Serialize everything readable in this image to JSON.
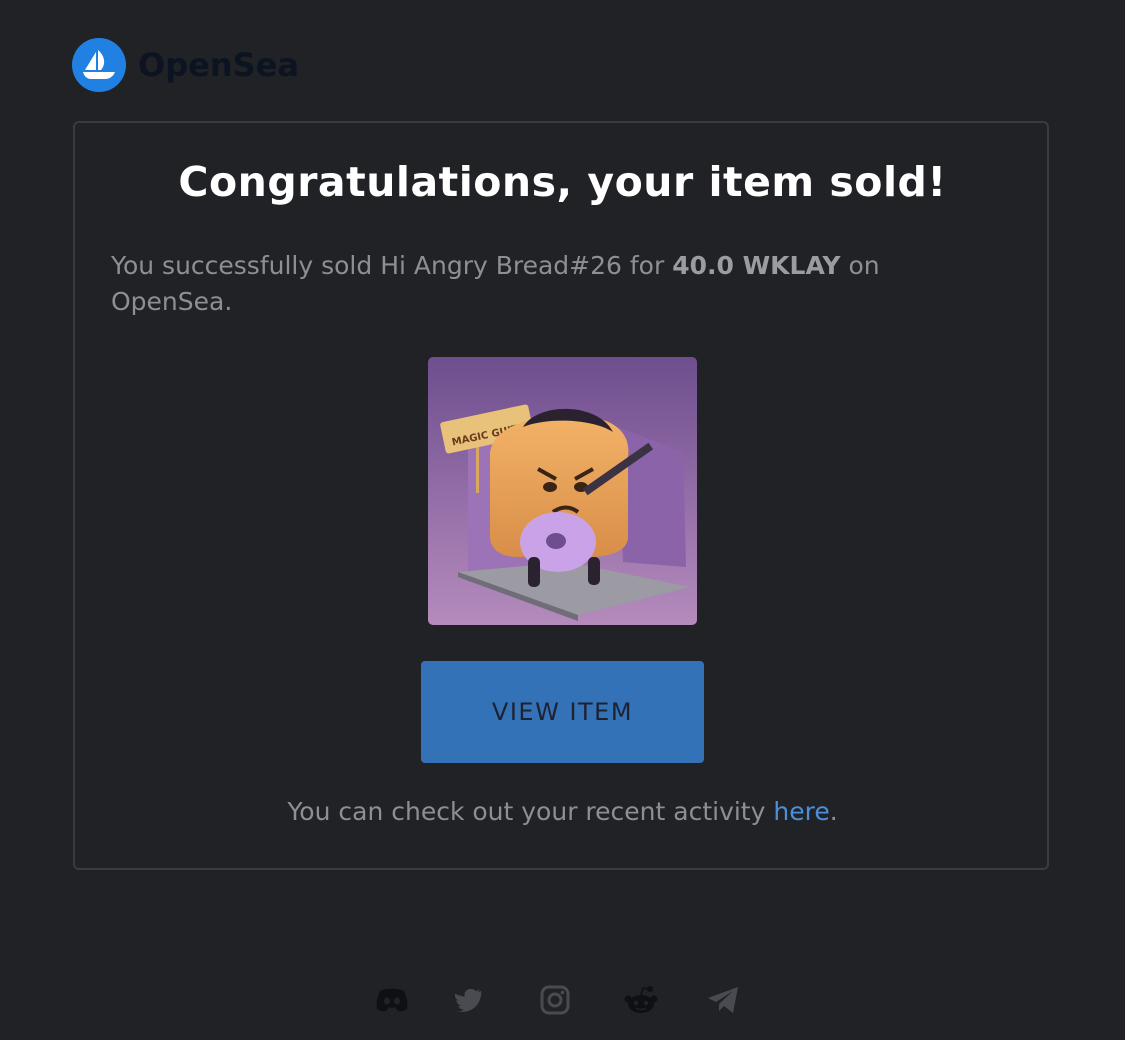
{
  "brand": {
    "name": "OpenSea",
    "logo_color": "#2081e2",
    "logo_icon": "ship-icon"
  },
  "card": {
    "headline": "Congratulations, your item sold!",
    "message_prefix": "You successfully sold Hi Angry Bread#26 for ",
    "price": "40.0 WKLAY",
    "message_suffix": " on OpenSea.",
    "item_image": {
      "caption_text": "MAGIC GUITAR",
      "bg_color": "#7a5b9c"
    },
    "button_label": "VIEW ITEM",
    "button_color": "#3472b8",
    "activity_prefix": "You can check out your recent activity ",
    "activity_link": "here",
    "activity_suffix": "."
  },
  "footer": {
    "social_icons": [
      "discord-icon",
      "twitter-icon",
      "instagram-icon",
      "reddit-icon",
      "telegram-icon"
    ]
  },
  "colors": {
    "background": "#212226",
    "link": "#4b8fd8",
    "muted_text": "#8d8f95"
  }
}
